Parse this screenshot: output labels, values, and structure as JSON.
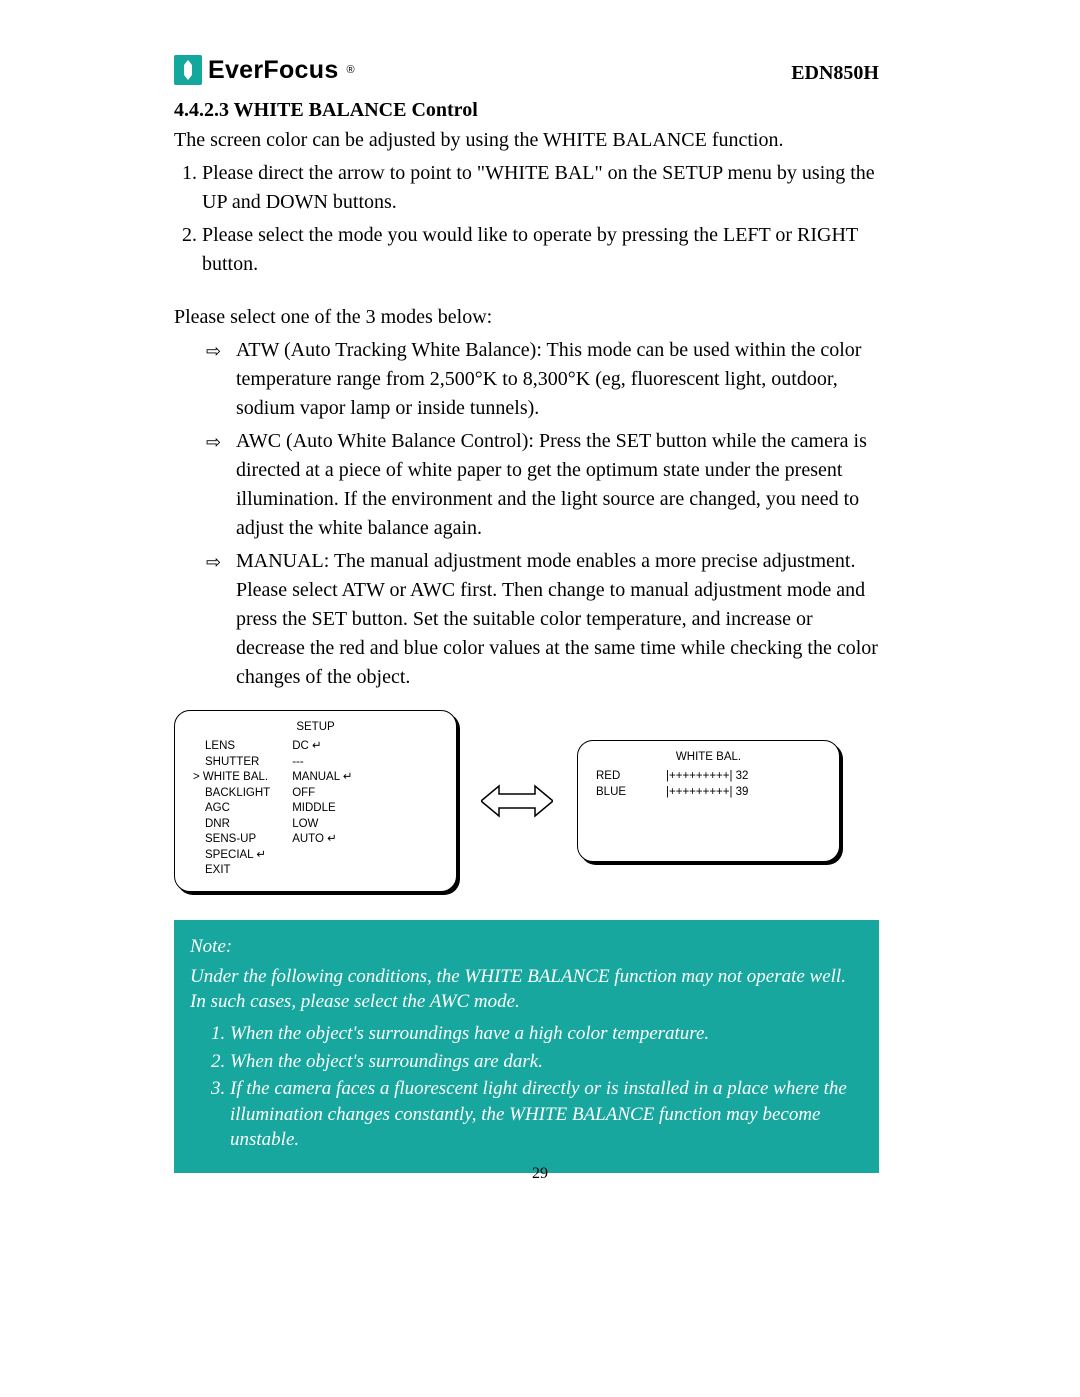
{
  "brand": "EverFocus",
  "brand_reg": "®",
  "model": "EDN850H",
  "section_number": "4.4.2.3",
  "section_title": "WHITE BALANCE Control",
  "intro": "The screen color can be adjusted by using the WHITE BALANCE function.",
  "steps": [
    "Please direct the arrow to point to \"WHITE BAL\" on the SETUP menu by using the UP and DOWN buttons.",
    "Please select the mode you would like to operate by pressing the LEFT or RIGHT button."
  ],
  "modes_intro": "Please select one of the 3 modes below:",
  "modes": [
    "ATW (Auto Tracking White Balance): This mode can be used within the color temperature range from 2,500°K to 8,300°K (eg, fluorescent light, outdoor, sodium vapor lamp or inside tunnels).",
    "AWC (Auto White Balance Control): Press the SET button while the camera is directed at a piece of white paper to get the optimum state under the present illumination. If the environment and the light source are changed, you need to adjust the white balance again.",
    "MANUAL: The manual adjustment mode enables a more precise adjustment. Please select ATW or AWC first. Then change to manual adjustment mode and press the SET button. Set the suitable color temperature, and increase or decrease the red and blue color values at the same time while checking the color changes of the object."
  ],
  "osd_setup": {
    "title": "SETUP",
    "rows": [
      {
        "label": "LENS",
        "value": "DC ↵"
      },
      {
        "label": "SHUTTER",
        "value": "---"
      },
      {
        "label": "WHITE BAL.",
        "value": "MANUAL ↵",
        "selected": true
      },
      {
        "label": "BACKLIGHT",
        "value": "OFF"
      },
      {
        "label": "AGC",
        "value": "MIDDLE"
      },
      {
        "label": "DNR",
        "value": "LOW"
      },
      {
        "label": "SENS-UP",
        "value": "AUTO ↵"
      },
      {
        "label": "SPECIAL ↵",
        "value": ""
      },
      {
        "label": "EXIT",
        "value": ""
      }
    ]
  },
  "osd_wb": {
    "title": "WHITE BAL.",
    "red_label": "RED",
    "blue_label": "BLUE",
    "red_bar": "|+++++++++| 32",
    "blue_bar": "|+++++++++| 39"
  },
  "note": {
    "title": "Note:",
    "lead": "Under the following conditions, the WHITE BALANCE function may not operate well. In such cases, please select the AWC mode.",
    "items": [
      "When the object's surroundings have a high color temperature.",
      "When the object's surroundings are dark.",
      "If the camera faces a fluorescent light directly or is installed in a place where the illumination changes constantly, the WHITE BALANCE function may become unstable."
    ]
  },
  "page_number": "29"
}
